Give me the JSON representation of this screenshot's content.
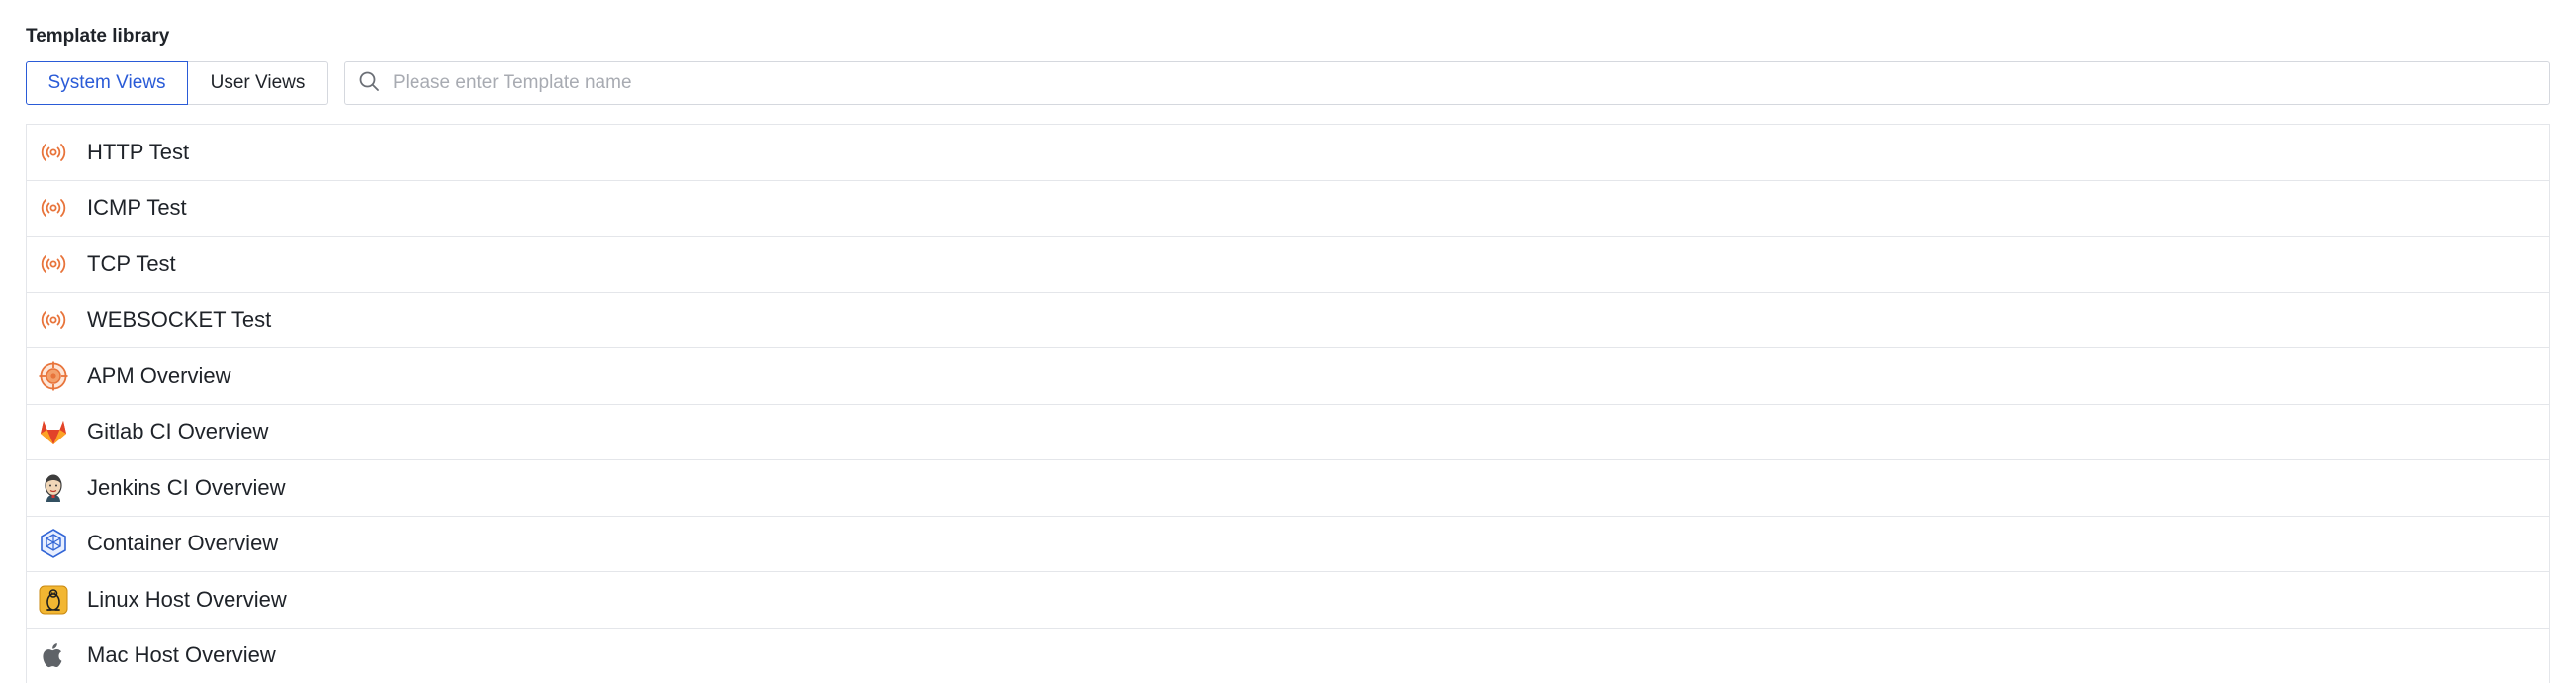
{
  "page": {
    "title": "Template library"
  },
  "tabs": [
    {
      "label": "System Views",
      "active": true
    },
    {
      "label": "User Views",
      "active": false
    }
  ],
  "search": {
    "placeholder": "Please enter Template name",
    "value": ""
  },
  "templates": [
    {
      "label": "HTTP Test",
      "icon": "broadcast-icon"
    },
    {
      "label": "ICMP Test",
      "icon": "broadcast-icon"
    },
    {
      "label": "TCP Test",
      "icon": "broadcast-icon"
    },
    {
      "label": "WEBSOCKET Test",
      "icon": "broadcast-icon"
    },
    {
      "label": "APM Overview",
      "icon": "target-icon"
    },
    {
      "label": "Gitlab CI Overview",
      "icon": "gitlab-icon"
    },
    {
      "label": "Jenkins CI Overview",
      "icon": "jenkins-icon"
    },
    {
      "label": "Container Overview",
      "icon": "container-icon"
    },
    {
      "label": "Linux Host Overview",
      "icon": "linux-icon"
    },
    {
      "label": "Mac Host Overview",
      "icon": "apple-icon"
    }
  ],
  "colors": {
    "accent": "#2a5bd7",
    "broadcast": "#e8743b",
    "border": "#e4e6ea"
  }
}
